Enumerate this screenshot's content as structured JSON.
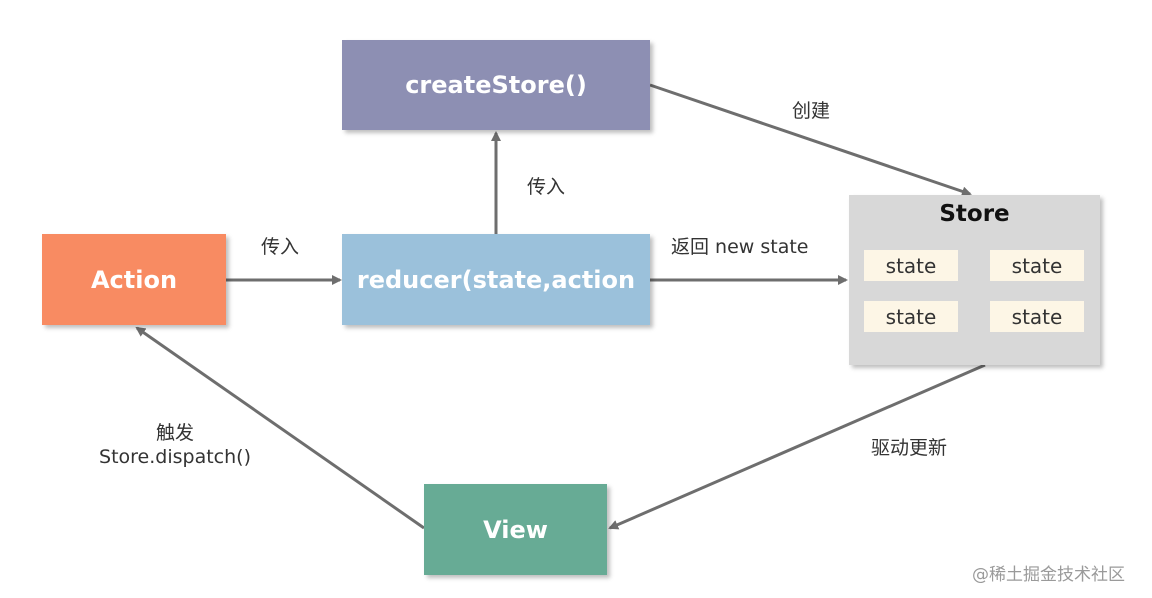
{
  "diagram": {
    "nodes": {
      "createstore": {
        "label": "createStore()",
        "color": "#8d8fb3"
      },
      "action": {
        "label": "Action",
        "color": "#f88b62"
      },
      "reducer": {
        "label": "reducer(state,action",
        "color": "#9bc1db"
      },
      "view": {
        "label": "View",
        "color": "#67ab95"
      },
      "store": {
        "label": "Store",
        "color": "#d8d8d8",
        "states": [
          "state",
          "state",
          "state",
          "state"
        ]
      }
    },
    "edges": [
      {
        "from": "action",
        "to": "reducer",
        "label": "传入"
      },
      {
        "from": "reducer",
        "to": "createstore",
        "label": "传入"
      },
      {
        "from": "createstore",
        "to": "store",
        "label": "创建"
      },
      {
        "from": "reducer",
        "to": "store",
        "label": "返回 new state"
      },
      {
        "from": "store",
        "to": "view",
        "label": "驱动更新"
      },
      {
        "from": "view",
        "to": "action",
        "label_line1": "触发",
        "label_line2": "Store.dispatch()"
      }
    ]
  },
  "watermark": "@稀土掘金技术社区"
}
